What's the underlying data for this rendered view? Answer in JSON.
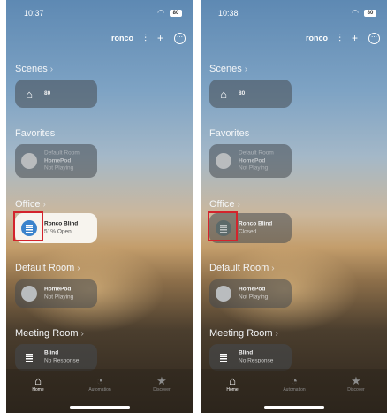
{
  "left": {
    "time": "10:37",
    "battery": "80",
    "home_name": "ronco",
    "sections": {
      "scenes": "Scenes",
      "favorites": "Favorites",
      "office": "Office",
      "default_room": "Default Room",
      "meeting_room": "Meeting Room"
    },
    "scene_tile": {
      "label": "80"
    },
    "favorite_tile": {
      "line1": "Default Room",
      "line2": "HomePod",
      "line3": "Not Playing"
    },
    "office_tile": {
      "name": "Ronco Blind",
      "status": "51% Open"
    },
    "default_room_tile": {
      "name": "HomePod",
      "status": "Not Playing"
    },
    "meeting_room_tile": {
      "name": "Blind",
      "status": "No Response"
    },
    "tabs": {
      "home": "Home",
      "automation": "Automation",
      "discover": "Discover"
    }
  },
  "right": {
    "time": "10:38",
    "battery": "80",
    "home_name": "ronco",
    "sections": {
      "scenes": "Scenes",
      "favorites": "Favorites",
      "office": "Office",
      "default_room": "Default Room",
      "meeting_room": "Meeting Room"
    },
    "scene_tile": {
      "label": "80"
    },
    "favorite_tile": {
      "line1": "Default Room",
      "line2": "HomePod",
      "line3": "Not Playing"
    },
    "office_tile": {
      "name": "Ronco Blind",
      "status": "Closed"
    },
    "default_room_tile": {
      "name": "HomePod",
      "status": "Not Playing"
    },
    "meeting_room_tile": {
      "name": "Blind",
      "status": "No Response"
    },
    "tabs": {
      "home": "Home",
      "automation": "Automation",
      "discover": "Discover"
    }
  },
  "colors": {
    "highlight": "#d3232c",
    "blind_on": "#3a83cc"
  },
  "icons": [
    "wifi-icon",
    "siri-waveform-icon",
    "plus-icon",
    "more-icon",
    "house-icon",
    "homepod-icon",
    "blind-icon",
    "star-icon"
  ]
}
